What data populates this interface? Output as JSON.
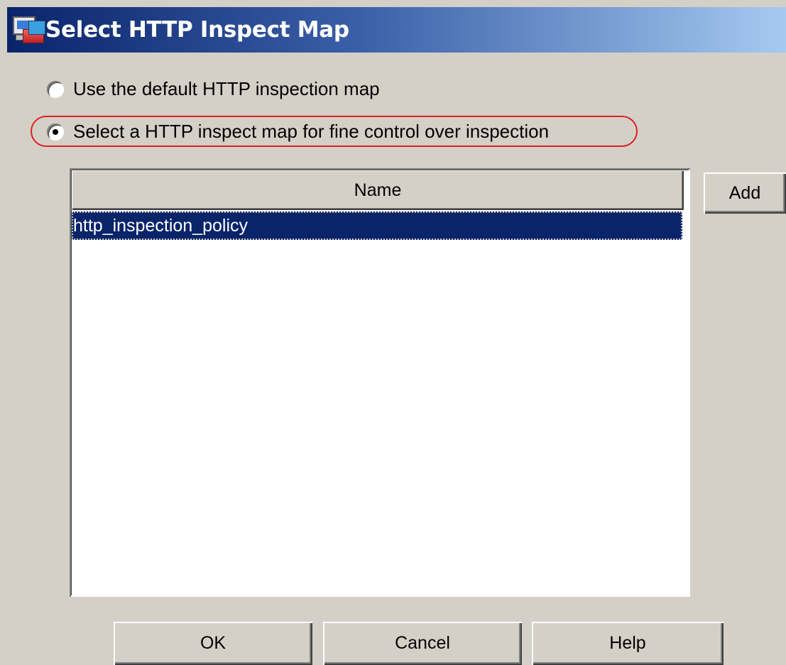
{
  "window": {
    "title": "Select HTTP Inspect Map",
    "title_icon": "asdm-app-icon"
  },
  "options": [
    {
      "label": "Use the default HTTP inspection map",
      "checked": false
    },
    {
      "label": "Select a HTTP inspect map for fine control over inspection",
      "checked": true
    }
  ],
  "table": {
    "header": "Name",
    "rows": [
      "http_inspection_policy"
    ],
    "selected_index": 0
  },
  "buttons": {
    "add": "Add",
    "ok": "OK",
    "cancel": "Cancel",
    "help": "Help"
  },
  "colors": {
    "title_gradient_start": "#0a246a",
    "title_gradient_end": "#a6caf0",
    "selection": "#0a246a",
    "highlight_oval": "#e02020",
    "dialog_bg": "#d4d0c8"
  }
}
